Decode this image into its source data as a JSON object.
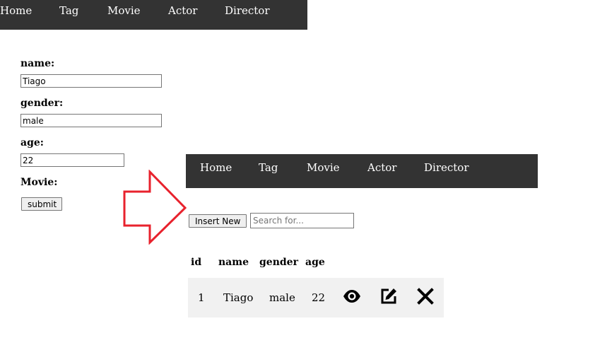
{
  "nav_top": {
    "items": [
      "Home",
      "Tag",
      "Movie",
      "Actor",
      "Director"
    ]
  },
  "form": {
    "name_label": "name:",
    "name_value": "Tiago",
    "gender_label": "gender:",
    "gender_value": "male",
    "age_label": "age:",
    "age_value": "22",
    "movie_label": "Movie:",
    "submit_label": "submit"
  },
  "nav_bottom": {
    "items": [
      "Home",
      "Tag",
      "Movie",
      "Actor",
      "Director"
    ]
  },
  "list": {
    "insert_label": "Insert New",
    "search_placeholder": "Search for...",
    "columns": [
      "id",
      "name",
      "gender",
      "age"
    ],
    "rows": [
      {
        "id": "1",
        "name": "Tiago",
        "gender": "male",
        "age": "22"
      }
    ]
  },
  "colors": {
    "nav_bg": "#333333",
    "arrow": "#e8222d",
    "row_bg": "#f1f1f1"
  },
  "icons": [
    "eye-icon",
    "edit-icon",
    "close-icon",
    "right-arrow-icon"
  ]
}
